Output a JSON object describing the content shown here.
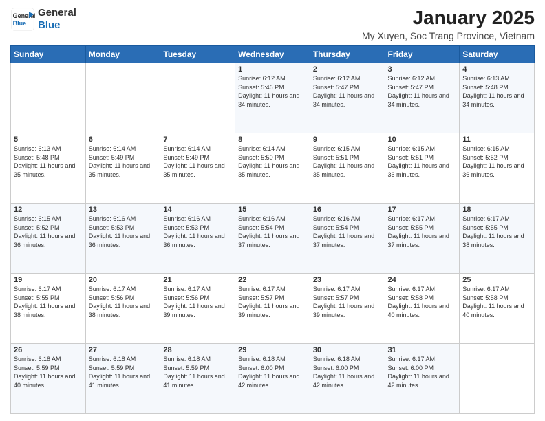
{
  "logo": {
    "general": "General",
    "blue": "Blue"
  },
  "title": "January 2025",
  "location": "My Xuyen, Soc Trang Province, Vietnam",
  "days_of_week": [
    "Sunday",
    "Monday",
    "Tuesday",
    "Wednesday",
    "Thursday",
    "Friday",
    "Saturday"
  ],
  "weeks": [
    [
      {
        "day": "",
        "text": ""
      },
      {
        "day": "",
        "text": ""
      },
      {
        "day": "",
        "text": ""
      },
      {
        "day": "1",
        "text": "Sunrise: 6:12 AM\nSunset: 5:46 PM\nDaylight: 11 hours and 34 minutes."
      },
      {
        "day": "2",
        "text": "Sunrise: 6:12 AM\nSunset: 5:47 PM\nDaylight: 11 hours and 34 minutes."
      },
      {
        "day": "3",
        "text": "Sunrise: 6:12 AM\nSunset: 5:47 PM\nDaylight: 11 hours and 34 minutes."
      },
      {
        "day": "4",
        "text": "Sunrise: 6:13 AM\nSunset: 5:48 PM\nDaylight: 11 hours and 34 minutes."
      }
    ],
    [
      {
        "day": "5",
        "text": "Sunrise: 6:13 AM\nSunset: 5:48 PM\nDaylight: 11 hours and 35 minutes."
      },
      {
        "day": "6",
        "text": "Sunrise: 6:14 AM\nSunset: 5:49 PM\nDaylight: 11 hours and 35 minutes."
      },
      {
        "day": "7",
        "text": "Sunrise: 6:14 AM\nSunset: 5:49 PM\nDaylight: 11 hours and 35 minutes."
      },
      {
        "day": "8",
        "text": "Sunrise: 6:14 AM\nSunset: 5:50 PM\nDaylight: 11 hours and 35 minutes."
      },
      {
        "day": "9",
        "text": "Sunrise: 6:15 AM\nSunset: 5:51 PM\nDaylight: 11 hours and 35 minutes."
      },
      {
        "day": "10",
        "text": "Sunrise: 6:15 AM\nSunset: 5:51 PM\nDaylight: 11 hours and 36 minutes."
      },
      {
        "day": "11",
        "text": "Sunrise: 6:15 AM\nSunset: 5:52 PM\nDaylight: 11 hours and 36 minutes."
      }
    ],
    [
      {
        "day": "12",
        "text": "Sunrise: 6:15 AM\nSunset: 5:52 PM\nDaylight: 11 hours and 36 minutes."
      },
      {
        "day": "13",
        "text": "Sunrise: 6:16 AM\nSunset: 5:53 PM\nDaylight: 11 hours and 36 minutes."
      },
      {
        "day": "14",
        "text": "Sunrise: 6:16 AM\nSunset: 5:53 PM\nDaylight: 11 hours and 36 minutes."
      },
      {
        "day": "15",
        "text": "Sunrise: 6:16 AM\nSunset: 5:54 PM\nDaylight: 11 hours and 37 minutes."
      },
      {
        "day": "16",
        "text": "Sunrise: 6:16 AM\nSunset: 5:54 PM\nDaylight: 11 hours and 37 minutes."
      },
      {
        "day": "17",
        "text": "Sunrise: 6:17 AM\nSunset: 5:55 PM\nDaylight: 11 hours and 37 minutes."
      },
      {
        "day": "18",
        "text": "Sunrise: 6:17 AM\nSunset: 5:55 PM\nDaylight: 11 hours and 38 minutes."
      }
    ],
    [
      {
        "day": "19",
        "text": "Sunrise: 6:17 AM\nSunset: 5:55 PM\nDaylight: 11 hours and 38 minutes."
      },
      {
        "day": "20",
        "text": "Sunrise: 6:17 AM\nSunset: 5:56 PM\nDaylight: 11 hours and 38 minutes."
      },
      {
        "day": "21",
        "text": "Sunrise: 6:17 AM\nSunset: 5:56 PM\nDaylight: 11 hours and 39 minutes."
      },
      {
        "day": "22",
        "text": "Sunrise: 6:17 AM\nSunset: 5:57 PM\nDaylight: 11 hours and 39 minutes."
      },
      {
        "day": "23",
        "text": "Sunrise: 6:17 AM\nSunset: 5:57 PM\nDaylight: 11 hours and 39 minutes."
      },
      {
        "day": "24",
        "text": "Sunrise: 6:17 AM\nSunset: 5:58 PM\nDaylight: 11 hours and 40 minutes."
      },
      {
        "day": "25",
        "text": "Sunrise: 6:17 AM\nSunset: 5:58 PM\nDaylight: 11 hours and 40 minutes."
      }
    ],
    [
      {
        "day": "26",
        "text": "Sunrise: 6:18 AM\nSunset: 5:59 PM\nDaylight: 11 hours and 40 minutes."
      },
      {
        "day": "27",
        "text": "Sunrise: 6:18 AM\nSunset: 5:59 PM\nDaylight: 11 hours and 41 minutes."
      },
      {
        "day": "28",
        "text": "Sunrise: 6:18 AM\nSunset: 5:59 PM\nDaylight: 11 hours and 41 minutes."
      },
      {
        "day": "29",
        "text": "Sunrise: 6:18 AM\nSunset: 6:00 PM\nDaylight: 11 hours and 42 minutes."
      },
      {
        "day": "30",
        "text": "Sunrise: 6:18 AM\nSunset: 6:00 PM\nDaylight: 11 hours and 42 minutes."
      },
      {
        "day": "31",
        "text": "Sunrise: 6:17 AM\nSunset: 6:00 PM\nDaylight: 11 hours and 42 minutes."
      },
      {
        "day": "",
        "text": ""
      }
    ]
  ]
}
